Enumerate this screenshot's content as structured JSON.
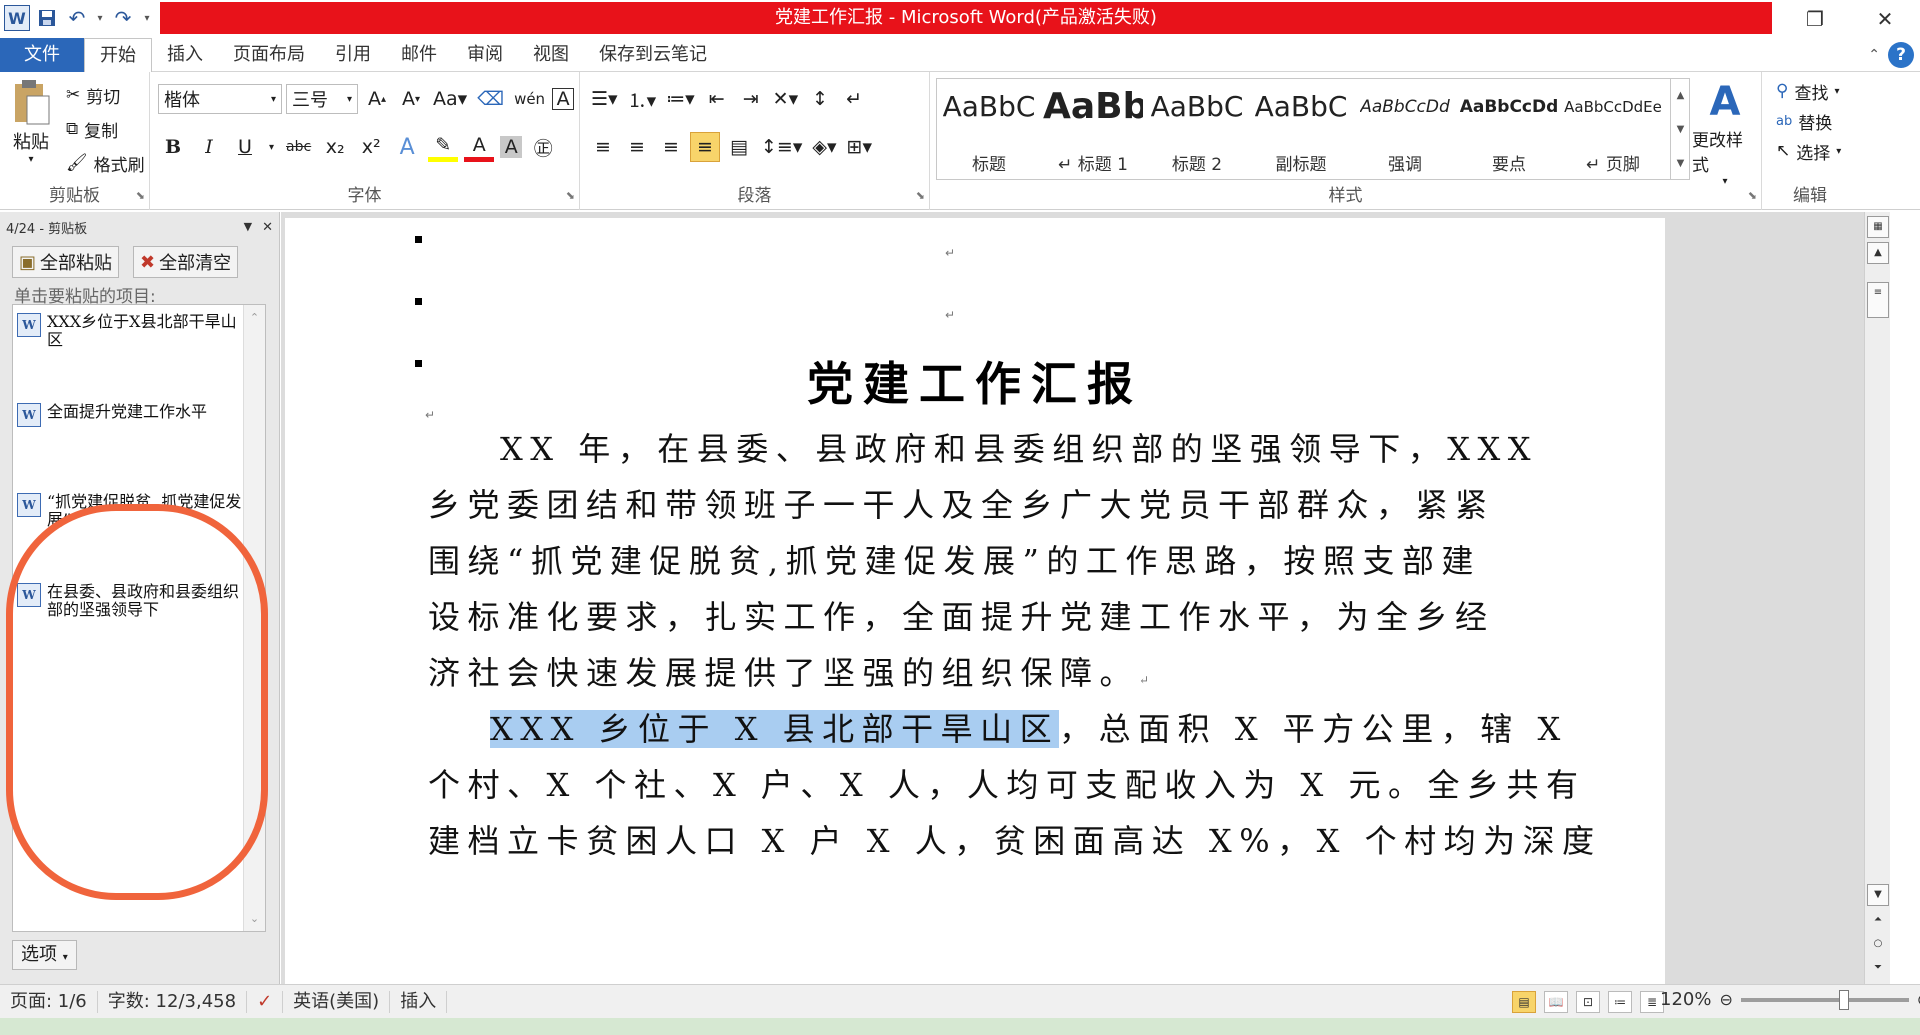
{
  "window": {
    "title": "党建工作汇报 - Microsoft Word(产品激活失败)"
  },
  "qat": {
    "word_icon": "W",
    "save_icon": "floppy-disk",
    "undo_icon": "undo-arrow",
    "redo_icon": "redo-arrow"
  },
  "tabs": [
    "文件",
    "开始",
    "插入",
    "页面布局",
    "引用",
    "邮件",
    "审阅",
    "视图",
    "保存到云笔记"
  ],
  "ribbon": {
    "clipboard": {
      "paste": "粘贴",
      "cut": "剪切",
      "copy": "复制",
      "format_painter": "格式刷",
      "label": "剪贴板"
    },
    "font": {
      "name": "楷体",
      "size": "三号",
      "label": "字体",
      "bold": "B",
      "italic": "I",
      "underline": "U",
      "strike": "abc"
    },
    "paragraph": {
      "label": "段落"
    },
    "styles": {
      "items": [
        {
          "preview": "AaBbC",
          "name": "标题"
        },
        {
          "preview": "AaBb",
          "name": "↵ 标题 1"
        },
        {
          "preview": "AaBbC",
          "name": "标题 2"
        },
        {
          "preview": "AaBbC",
          "name": "副标题"
        },
        {
          "preview": "AaBbCcDd",
          "name": "强调"
        },
        {
          "preview": "AaBbCcDd",
          "name": "要点"
        },
        {
          "preview": "AaBbCcDdEe",
          "name": "↵ 页脚"
        }
      ],
      "change": "更改样式",
      "label": "样式"
    },
    "editing": {
      "find": "查找",
      "replace": "替换",
      "select": "选择",
      "label": "编辑"
    }
  },
  "clipboard_pane": {
    "header": "4/24 - 剪贴板",
    "paste_all": "全部粘贴",
    "clear_all": "全部清空",
    "hint": "单击要粘贴的项目:",
    "items": [
      "XXX乡位于X县北部干旱山区",
      "全面提升党建工作水平",
      "“抓党建促脱贫, 抓党建促发展”",
      "在县委、县政府和县委组织部的坚强领导下"
    ],
    "options": "选项"
  },
  "document": {
    "title": "党建工作汇报",
    "lines": [
      "XX 年，在县委、县政府和县委组织部的坚强领导下，XXX",
      "乡党委团结和带领班子一干人及全乡广大党员干部群众，紧紧",
      "围绕“抓党建促脱贫,抓党建促发展”的工作思路，按照支部建",
      "设标准化要求，扎实工作，全面提升党建工作水平，为全乡经",
      "济社会快速发展提供了坚强的组织保障。"
    ],
    "highlighted": "XXX 乡位于 X 县北部干旱山区",
    "line6_rest": "，总面积 X 平方公里，辖 X",
    "lines_after": [
      "个村、X 个社、X 户、X 人，人均可支配收入为 X 元。全乡共有",
      "建档立卡贫困人口 X 户 X 人，贫困面高达 X%，X 个村均为深度"
    ],
    "para_mark": "↵"
  },
  "status": {
    "page": "页面: 1/6",
    "words": "字数: 12/3,458",
    "language": "英语(美国)",
    "mode": "插入",
    "zoom": "120%"
  },
  "colors": {
    "title_bar": "#e8121a",
    "file_tab": "#2b67b9",
    "highlight": "#a9cdf1",
    "annotation_oval": "#f0643c"
  }
}
